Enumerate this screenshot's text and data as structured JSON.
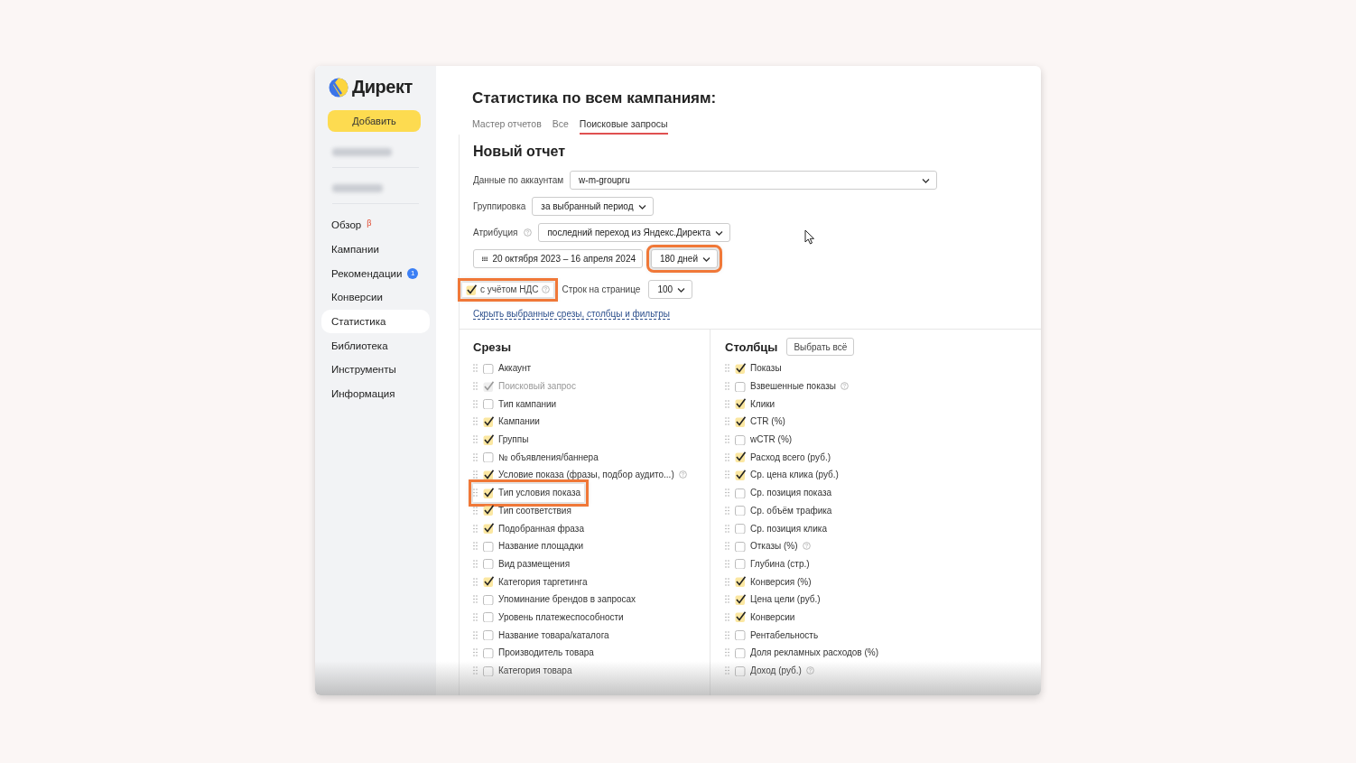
{
  "sidebar": {
    "logo": "Директ",
    "add_button": "Добавить",
    "items": [
      {
        "label": "Обзор",
        "badge": {
          "text": "β",
          "kind": "beta"
        },
        "selected": false
      },
      {
        "label": "Кампании",
        "selected": false
      },
      {
        "label": "Рекомендации",
        "badge": {
          "text": "1",
          "kind": "count"
        },
        "selected": false
      },
      {
        "label": "Конверсии",
        "selected": false
      },
      {
        "label": "Статистика",
        "selected": true
      },
      {
        "label": "Библиотека",
        "selected": false
      },
      {
        "label": "Инструменты",
        "selected": false
      },
      {
        "label": "Информация",
        "selected": false
      }
    ]
  },
  "page_title": "Статистика по всем кампаниям:",
  "tabs": [
    {
      "label": "Мастер отчетов",
      "selected": false
    },
    {
      "label": "Все",
      "selected": false
    },
    {
      "label": "Поисковые запросы",
      "selected": true
    }
  ],
  "report": {
    "title": "Новый отчет",
    "account": {
      "label": "Данные по аккаунтам",
      "value": "w-m-groupru"
    },
    "grouping": {
      "label": "Группировка",
      "value": "за выбранный период"
    },
    "attribution": {
      "label": "Атрибуция",
      "value": "последний переход из Яндекс.Директа"
    },
    "date_range": "20 октября 2023 – 16 апреля 2024",
    "period": {
      "value": "180 дней",
      "highlighted": true
    },
    "vat": {
      "label": "с учётом НДС",
      "checked": true,
      "highlighted": true
    },
    "rows_per_page": {
      "label": "Строк на странице",
      "value": "100"
    },
    "hide_link": "Скрыть выбранные срезы, столбцы и фильтры"
  },
  "slices": {
    "title": "Срезы",
    "items": [
      {
        "label": "Аккаунт",
        "checked": false,
        "disabled": false,
        "help": false,
        "highlighted": false
      },
      {
        "label": "Поисковый запрос",
        "checked": true,
        "disabled": true,
        "help": false,
        "highlighted": false
      },
      {
        "label": "Тип кампании",
        "checked": false,
        "disabled": false,
        "help": false,
        "highlighted": false
      },
      {
        "label": "Кампании",
        "checked": true,
        "disabled": false,
        "help": false,
        "highlighted": false
      },
      {
        "label": "Группы",
        "checked": true,
        "disabled": false,
        "help": false,
        "highlighted": false
      },
      {
        "label": "№ объявления/баннера",
        "checked": false,
        "disabled": false,
        "help": false,
        "highlighted": false
      },
      {
        "label": "Условие показа (фразы, подбор аудито...)",
        "checked": true,
        "disabled": false,
        "help": true,
        "highlighted": false
      },
      {
        "label": "Тип условия показа",
        "checked": true,
        "disabled": false,
        "help": false,
        "highlighted": true
      },
      {
        "label": "Тип соответствия",
        "checked": true,
        "disabled": false,
        "help": false,
        "highlighted": false
      },
      {
        "label": "Подобранная фраза",
        "checked": true,
        "disabled": false,
        "help": false,
        "highlighted": false
      },
      {
        "label": "Название площадки",
        "checked": false,
        "disabled": false,
        "help": false,
        "highlighted": false
      },
      {
        "label": "Вид размещения",
        "checked": false,
        "disabled": false,
        "help": false,
        "highlighted": false
      },
      {
        "label": "Категория таргетинга",
        "checked": true,
        "disabled": false,
        "help": false,
        "highlighted": false
      },
      {
        "label": "Упоминание брендов в запросах",
        "checked": false,
        "disabled": false,
        "help": false,
        "highlighted": false
      },
      {
        "label": "Уровень платежеспособности",
        "checked": false,
        "disabled": false,
        "help": false,
        "highlighted": false
      },
      {
        "label": "Название товара/каталога",
        "checked": false,
        "disabled": false,
        "help": false,
        "highlighted": false
      },
      {
        "label": "Производитель товара",
        "checked": false,
        "disabled": false,
        "help": false,
        "highlighted": false
      },
      {
        "label": "Категория товара",
        "checked": false,
        "disabled": false,
        "help": false,
        "highlighted": false
      }
    ]
  },
  "columns": {
    "title": "Столбцы",
    "select_all": "Выбрать всё",
    "items": [
      {
        "label": "Показы",
        "checked": true,
        "help": false
      },
      {
        "label": "Взвешенные показы",
        "checked": false,
        "help": true
      },
      {
        "label": "Клики",
        "checked": true,
        "help": false
      },
      {
        "label": "CTR (%)",
        "checked": true,
        "help": false
      },
      {
        "label": "wCTR (%)",
        "checked": false,
        "help": false
      },
      {
        "label": "Расход всего (руб.)",
        "checked": true,
        "help": false
      },
      {
        "label": "Ср. цена клика (руб.)",
        "checked": true,
        "help": false
      },
      {
        "label": "Ср. позиция показа",
        "checked": false,
        "help": false
      },
      {
        "label": "Ср. объём трафика",
        "checked": false,
        "help": false
      },
      {
        "label": "Ср. позиция клика",
        "checked": false,
        "help": false
      },
      {
        "label": "Отказы (%)",
        "checked": false,
        "help": true
      },
      {
        "label": "Глубина (стр.)",
        "checked": false,
        "help": false
      },
      {
        "label": "Конверсия (%)",
        "checked": true,
        "help": false
      },
      {
        "label": "Цена цели (руб.)",
        "checked": true,
        "help": false
      },
      {
        "label": "Конверсии",
        "checked": true,
        "help": false
      },
      {
        "label": "Рентабельность",
        "checked": false,
        "help": false
      },
      {
        "label": "Доля рекламных расходов (%)",
        "checked": false,
        "help": false
      },
      {
        "label": "Доход (руб.)",
        "checked": false,
        "help": true
      }
    ]
  }
}
